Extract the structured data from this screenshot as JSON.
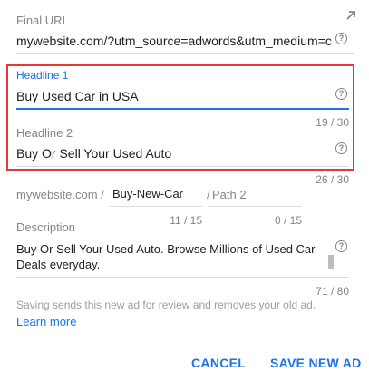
{
  "final_url": {
    "label": "Final URL",
    "value": "mywebsite.com/?utm_source=adwords&utm_medium=cpc&",
    "help": "?"
  },
  "headline1": {
    "label": "Headline 1",
    "value": "Buy Used Car in USA",
    "counter": "19 / 30",
    "help": "?"
  },
  "headline2": {
    "label": "Headline 2",
    "value": "Buy Or Sell Your Used Auto",
    "counter": "26 / 30",
    "help": "?"
  },
  "display_url": {
    "base": "mywebsite.com /",
    "path1_value": "Buy-New-Car",
    "path1_counter": "11 / 15",
    "separator": "/",
    "path2_placeholder": "Path 2",
    "path2_counter": "0 / 15"
  },
  "description": {
    "label": "Description",
    "value": "Buy Or Sell Your Used Auto. Browse Millions of Used Car Deals everyday.",
    "counter": "71 / 80",
    "help": "?"
  },
  "notice": "Saving sends this new ad for review and removes your old ad.",
  "learn_more": "Learn more",
  "actions": {
    "cancel": "CANCEL",
    "save": "SAVE NEW AD"
  },
  "colors": {
    "accent": "#1a73e8",
    "highlight_box": "#e53935",
    "muted": "#80868b"
  },
  "icons": {
    "expand": "expand-arrow-icon",
    "help": "help-circle-icon"
  }
}
